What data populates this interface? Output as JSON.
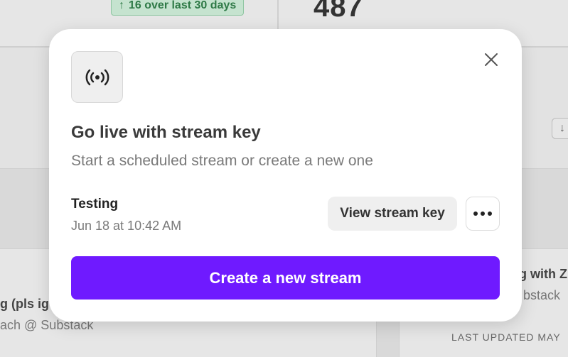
{
  "background": {
    "badge_text": "16 over last 30 days",
    "big_number": "487",
    "left_item_title": "g (pls ig",
    "left_item_subtitle": "ach @ Substack",
    "right_item_title": "g with Z",
    "right_item_subtitle": "bstack",
    "right_item_meta": "LAST UPDATED MAY"
  },
  "modal": {
    "icon": "broadcast-icon",
    "title": "Go live with stream key",
    "subtitle": "Start a scheduled stream or create a new one",
    "stream": {
      "name": "Testing",
      "date": "Jun 18 at 10:42 AM",
      "view_key_label": "View stream key"
    },
    "create_label": "Create a new stream"
  },
  "colors": {
    "accent": "#6f1aff",
    "badge_green": "#2f7a47"
  }
}
